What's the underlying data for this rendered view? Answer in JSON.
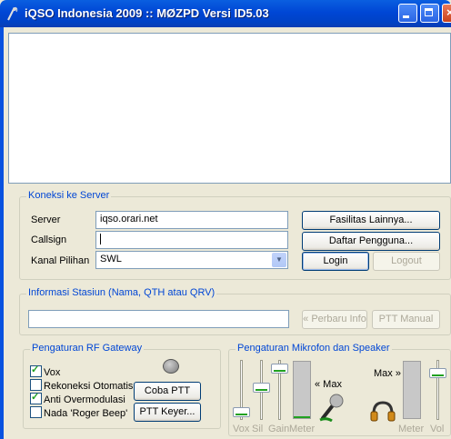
{
  "window": {
    "title": "iQSO Indonesia 2009 :: MØZPD Versi ID5.03"
  },
  "server_group": {
    "title": "Koneksi ke Server",
    "server_label": "Server",
    "server_value": "iqso.orari.net",
    "callsign_label": "Callsign",
    "callsign_value": "",
    "channel_label": "Kanal Pilihan",
    "channel_value": "SWL",
    "buttons": {
      "more_features": "Fasilitas Lainnya...",
      "user_list": "Daftar Pengguna...",
      "login": "Login",
      "logout": "Logout"
    }
  },
  "station_info": {
    "title": "Informasi Stasiun (Nama, QTH atau QRV)",
    "value": "",
    "update_button": "« Perbaru Info",
    "ptt_manual_button": "PTT Manual"
  },
  "rf_gateway": {
    "title": "Pengaturan RF Gateway",
    "options": [
      {
        "label": "Vox",
        "checked": true
      },
      {
        "label": "Rekoneksi Otomatis",
        "checked": false
      },
      {
        "label": "Anti Overmodulasi",
        "checked": true
      },
      {
        "label": "Nada 'Roger Beep'",
        "checked": false
      }
    ],
    "test_ptt_button": "Coba PTT",
    "ptt_keyer_button": "PTT Keyer...",
    "ptt_indicator": "grey"
  },
  "audio": {
    "title": "Pengaturan Mikrofon dan Speaker",
    "mic_max_label": "« Max",
    "speaker_max_label": "Max »",
    "slider_labels": {
      "vox": "Vox",
      "sil": "Sil",
      "gain": "Gain",
      "mic_meter": "Meter",
      "spk_meter": "Meter",
      "vol": "Vol"
    },
    "levels": {
      "vox": 0.05,
      "sil": 0.55,
      "gain": 0.93,
      "mic_meter": 0.04,
      "spk_meter": 0.0
    },
    "icons": {
      "mic": "microphone-icon",
      "speaker": "headphones-icon"
    }
  },
  "colors": {
    "group_title": "#0046d5",
    "meter_level": "#21a121",
    "titlebar": "#0046d5"
  }
}
